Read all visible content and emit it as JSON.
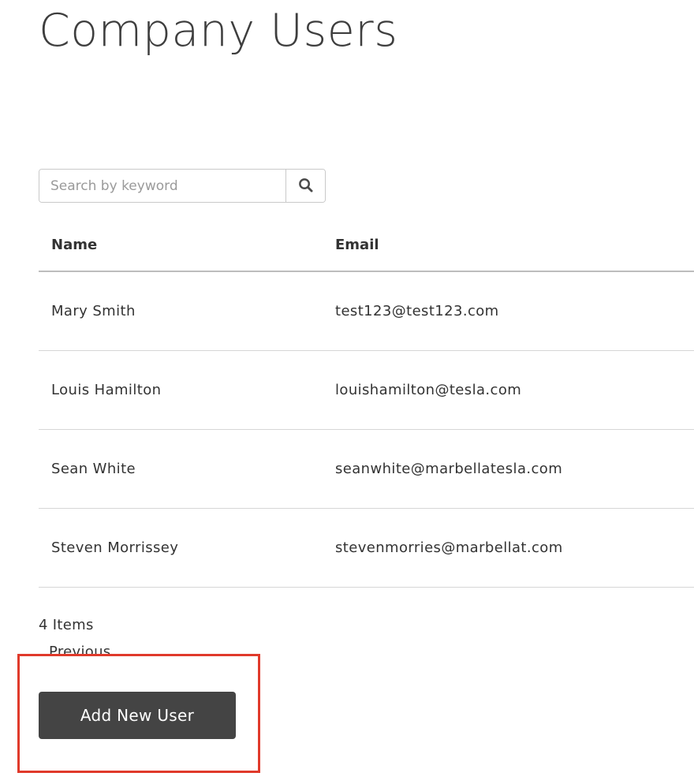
{
  "page": {
    "title": "Company Users"
  },
  "search": {
    "placeholder": "Search by keyword",
    "value": "",
    "button_icon": "search-icon"
  },
  "table": {
    "columns": [
      "Name",
      "Email"
    ],
    "rows": [
      {
        "name": "Mary Smith",
        "email": "test123@test123.com"
      },
      {
        "name": "Louis Hamilton",
        "email": "louishamilton@tesla.com"
      },
      {
        "name": "Sean White",
        "email": "seanwhite@marbellatesla.com"
      },
      {
        "name": "Steven Morrissey",
        "email": "stevenmorries@marbellat.com"
      }
    ]
  },
  "pagination": {
    "items_count": "4 Items",
    "previous_label": "Previous"
  },
  "actions": {
    "add_user_label": "Add New User"
  },
  "colors": {
    "button_bg": "#444444",
    "highlight_border": "#e03a2b",
    "title_text": "#3e3e3e"
  }
}
